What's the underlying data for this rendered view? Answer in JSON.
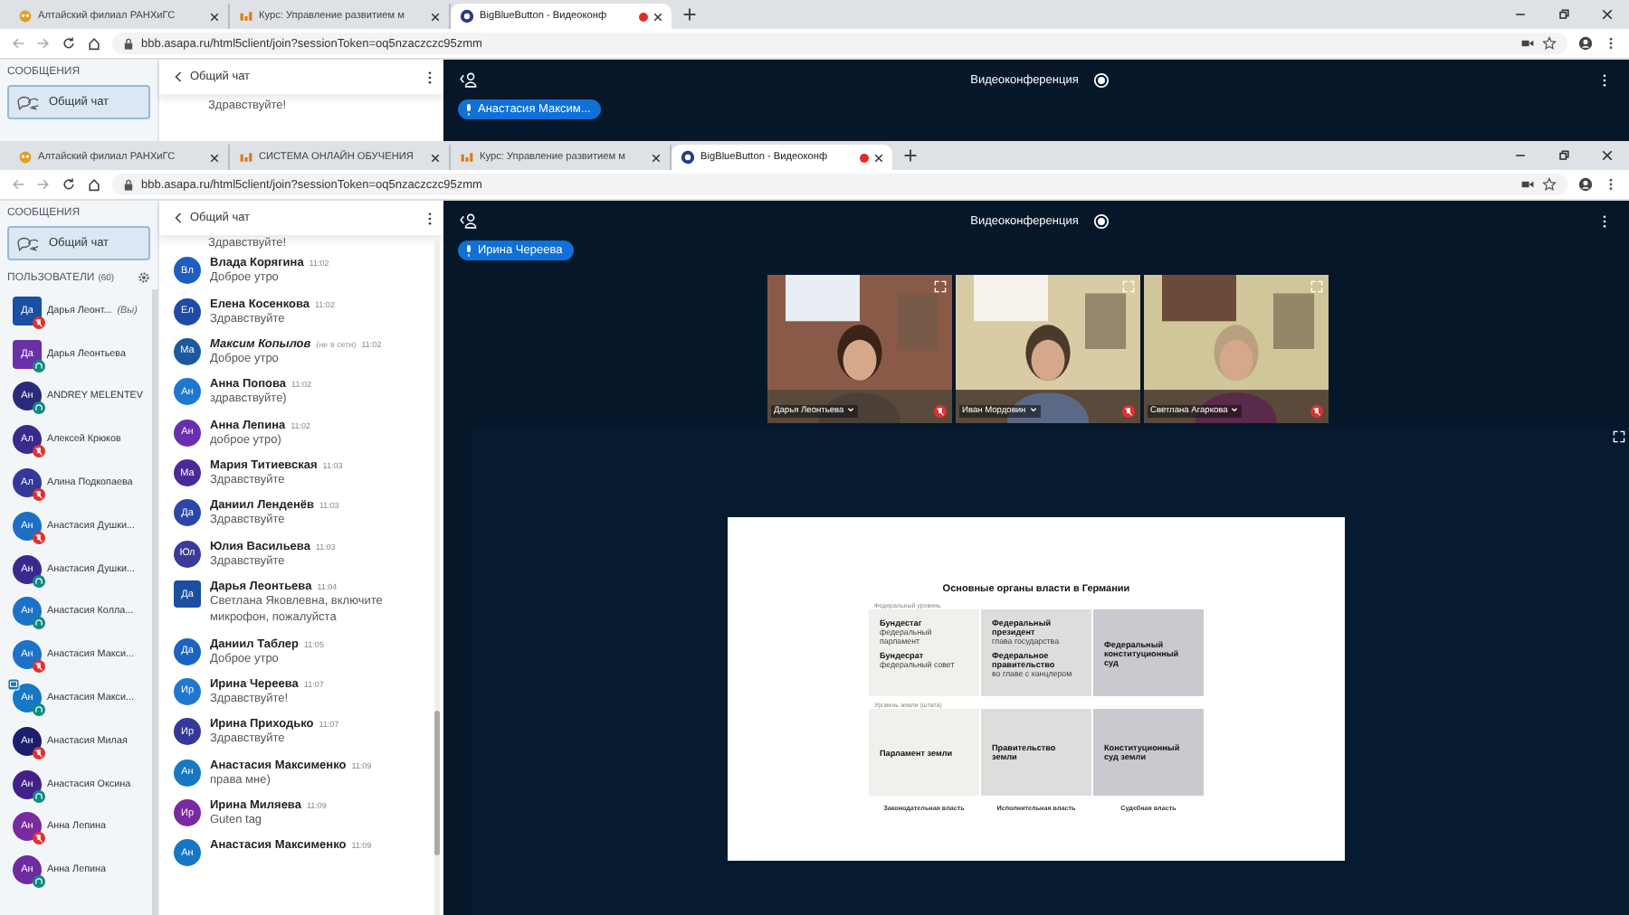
{
  "back_window": {
    "tabs": [
      {
        "label": "Алтайский филиал РАНХиГС",
        "selected": false
      },
      {
        "label": "Курс: Управление развитием м",
        "selected": false
      },
      {
        "label": "BigBlueButton - Видеоконф",
        "selected": true
      }
    ],
    "address": "bbb.asapa.ru/html5client/join?sessionToken=oq5nzaczczc95zmm",
    "messages_heading": "СООБЩЕНИЯ",
    "chat_button": "Общий чат",
    "chat_title": "Общий чат",
    "partial_message": "Здравствуйте!",
    "app_title": "Видеоконференция",
    "talking": "Анастасия Максим..."
  },
  "front_window": {
    "tabs": [
      {
        "label": "Алтайский филиал РАНХиГС",
        "selected": false
      },
      {
        "label": "СИСТЕМА ОНЛАЙН ОБУЧЕНИЯ",
        "selected": false
      },
      {
        "label": "Курс: Управление развитием м",
        "selected": false
      },
      {
        "label": "BigBlueButton - Видеоконф",
        "selected": true
      }
    ],
    "address": "bbb.asapa.ru/html5client/join?sessionToken=oq5nzaczczc95zmm",
    "sidebar": {
      "messages_heading": "СООБЩЕНИЯ",
      "chat_button": "Общий чат",
      "users_heading": "ПОЛЬЗОВАТЕЛИ",
      "users_count": "(60)",
      "users": [
        {
          "initials": "Да",
          "name": "Дарья Леонт...",
          "suffix": "(Вы)",
          "color": "#1a4fa3",
          "moderator": true,
          "muted": true,
          "presenter": false
        },
        {
          "initials": "Да",
          "name": "Дарья Леонтьева",
          "color": "#6b2fa8",
          "moderator": true,
          "muted": false,
          "presenter": false
        },
        {
          "initials": "Ан",
          "name": "ANDREY MELENTEV",
          "color": "#2b2a7a",
          "moderator": false,
          "muted": false,
          "presenter": false
        },
        {
          "initials": "Ал",
          "name": "Алексей Крюков",
          "color": "#3a2a8c",
          "moderator": false,
          "muted": true,
          "presenter": false
        },
        {
          "initials": "Ал",
          "name": "Алина Подкопаева",
          "color": "#33389a",
          "moderator": false,
          "muted": true,
          "presenter": false
        },
        {
          "initials": "Ан",
          "name": "Анастасия Душки...",
          "color": "#1b6fc7",
          "moderator": false,
          "muted": true,
          "presenter": false
        },
        {
          "initials": "Ан",
          "name": "Анастасия Душки...",
          "color": "#3b2a8e",
          "moderator": false,
          "muted": false,
          "presenter": false
        },
        {
          "initials": "Ан",
          "name": "Анастасия Колла...",
          "color": "#1c72c9",
          "moderator": false,
          "muted": false,
          "presenter": false
        },
        {
          "initials": "Ан",
          "name": "Анастасия Макси...",
          "color": "#1c72c9",
          "moderator": false,
          "muted": true,
          "presenter": false
        },
        {
          "initials": "Ан",
          "name": "Анастасия Макси...",
          "color": "#1677c4",
          "moderator": false,
          "muted": false,
          "presenter": true
        },
        {
          "initials": "Ан",
          "name": "Анастасия Милая",
          "color": "#1d1f6e",
          "moderator": false,
          "muted": true,
          "presenter": false
        },
        {
          "initials": "Ан",
          "name": "Анастасия Оксина",
          "color": "#43208a",
          "moderator": false,
          "muted": false,
          "presenter": false
        },
        {
          "initials": "Ан",
          "name": "Анна Лепина",
          "color": "#7a2aa0",
          "moderator": false,
          "muted": true,
          "presenter": false
        },
        {
          "initials": "Ан",
          "name": "Анна Лепина",
          "color": "#6e2c9e",
          "moderator": false,
          "muted": false,
          "presenter": false
        }
      ]
    },
    "chat": {
      "title": "Общий чат",
      "first_text": "Здравствуйте!",
      "messages": [
        {
          "initials": "Вл",
          "name": "Влада Корягина",
          "time": "11:02",
          "text": "Доброе утро",
          "color": "#1d5fc0",
          "moderator": false,
          "offline": false
        },
        {
          "initials": "Ел",
          "name": "Елена Косенкова",
          "time": "11:02",
          "text": "Здравствуйте",
          "color": "#1e4aa8",
          "moderator": false,
          "offline": false
        },
        {
          "initials": "Ма",
          "name": "Максим Копылов",
          "note": "(не в сети)",
          "time": "11:02",
          "text": "Доброе утро",
          "color": "#1c5a9e",
          "moderator": false,
          "offline": true
        },
        {
          "initials": "Ан",
          "name": "Анна Попова",
          "time": "11:02",
          "text": "здравствуйте)",
          "color": "#1f78d0",
          "moderator": false,
          "offline": false
        },
        {
          "initials": "Ан",
          "name": "Анна Лепина",
          "time": "11:02",
          "text": "доброе утро)",
          "color": "#6a2fb0",
          "moderator": false,
          "offline": false
        },
        {
          "initials": "Ма",
          "name": "Мария Титиевская",
          "time": "11:03",
          "text": "Здравствуйте",
          "color": "#4a2a96",
          "moderator": false,
          "offline": false
        },
        {
          "initials": "Да",
          "name": "Даниил Ленденёв",
          "time": "11:03",
          "text": "Здравствуйте",
          "color": "#2b48a8",
          "moderator": false,
          "offline": false
        },
        {
          "initials": "Юл",
          "name": "Юлия Васильева",
          "time": "11:03",
          "text": "Здравствуйте",
          "color": "#3a3a9a",
          "moderator": false,
          "offline": false
        },
        {
          "initials": "Да",
          "name": "Дарья Леонтьева",
          "time": "11:04",
          "text": "Светлана Яковлевна, включите микрофон, пожалуйста",
          "color": "#1a4fa3",
          "moderator": true,
          "offline": false
        },
        {
          "initials": "Да",
          "name": "Даниил Таблер",
          "time": "11:05",
          "text": "Доброе утро",
          "color": "#1b62c4",
          "moderator": false,
          "offline": false
        },
        {
          "initials": "Ир",
          "name": "Ирина Череева",
          "time": "11:07",
          "text": "Здравствуйте!",
          "color": "#1f78d0",
          "moderator": false,
          "offline": false
        },
        {
          "initials": "Ир",
          "name": "Ирина Приходько",
          "time": "11:07",
          "text": "Здравствуйте",
          "color": "#33389a",
          "moderator": false,
          "offline": false
        },
        {
          "initials": "Ан",
          "name": "Анастасия Максименко",
          "time": "11:09",
          "text": "права мне)",
          "color": "#1677c4",
          "moderator": false,
          "offline": false
        },
        {
          "initials": "Ир",
          "name": "Ирина Миляева",
          "time": "11:09",
          "text": "Guten tag",
          "color": "#7a2aa0",
          "moderator": false,
          "offline": false
        },
        {
          "initials": "Ан",
          "name": "Анастасия Максименко",
          "time": "11:09",
          "color": "#1677c4",
          "moderator": false,
          "offline": false
        }
      ]
    },
    "main": {
      "title": "Видеоконференция",
      "talking": "Ирина Череева",
      "videos": [
        {
          "name": "Дарья Леонтьева",
          "kind": "picture"
        },
        {
          "name": "Иван Мордовин",
          "kind": "picture"
        },
        {
          "name": "Светлана Агаркова",
          "kind": "picture"
        }
      ],
      "slide": {
        "title": "Основные органы власти в Германии",
        "federal_label": "Федеральный уровень",
        "state_label": "Уровень земли (штата)",
        "federal": [
          [
            {
              "head": "Бундестаг",
              "sub": "федеральный парламент"
            },
            {
              "head": "Бундесрат",
              "sub": "федеральный совет"
            }
          ],
          [
            {
              "head": "Федеральный президент",
              "sub": "глава государства"
            },
            {
              "head": "Федеральное правительство",
              "sub": "во главе с канцлером"
            }
          ],
          [
            {
              "head": "Федеральный конституционный суд"
            }
          ]
        ],
        "state": [
          "Парламент земли",
          "Правительство земли",
          "Конституционный суд земли"
        ],
        "branches": [
          "Законодательная власть",
          "Исполнительная власть",
          "Судебная власть"
        ]
      }
    }
  }
}
